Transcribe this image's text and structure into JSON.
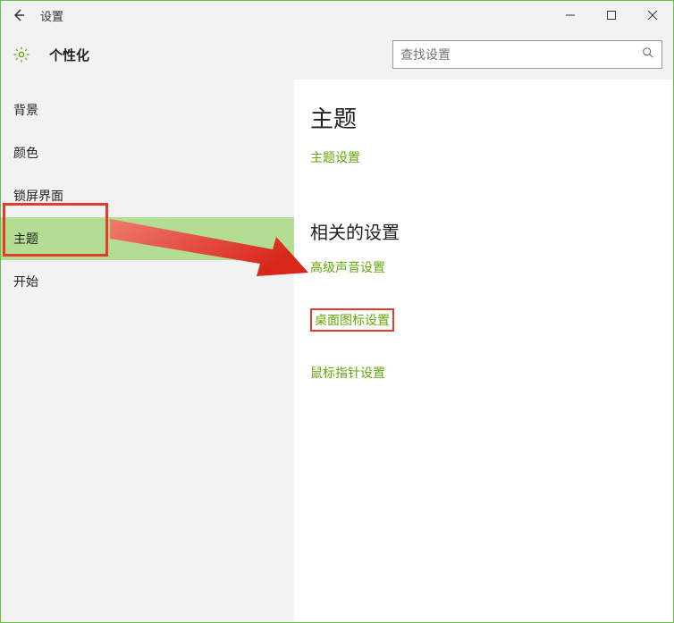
{
  "window": {
    "title": "设置"
  },
  "header": {
    "category": "个性化"
  },
  "search": {
    "placeholder": "查找设置"
  },
  "sidebar": {
    "items": [
      {
        "label": "背景"
      },
      {
        "label": "颜色"
      },
      {
        "label": "锁屏界面"
      },
      {
        "label": "主题"
      },
      {
        "label": "开始"
      }
    ]
  },
  "content": {
    "heading1": "主题",
    "link1": "主题设置",
    "heading2": "相关的设置",
    "link_sound": "高级声音设置",
    "link_desktop_icons": "桌面图标设置",
    "link_mouse": "鼠标指针设置"
  },
  "colors": {
    "accent": "#63a70a",
    "highlight_box": "#e33b2e",
    "active_nav": "#b3dd92"
  }
}
